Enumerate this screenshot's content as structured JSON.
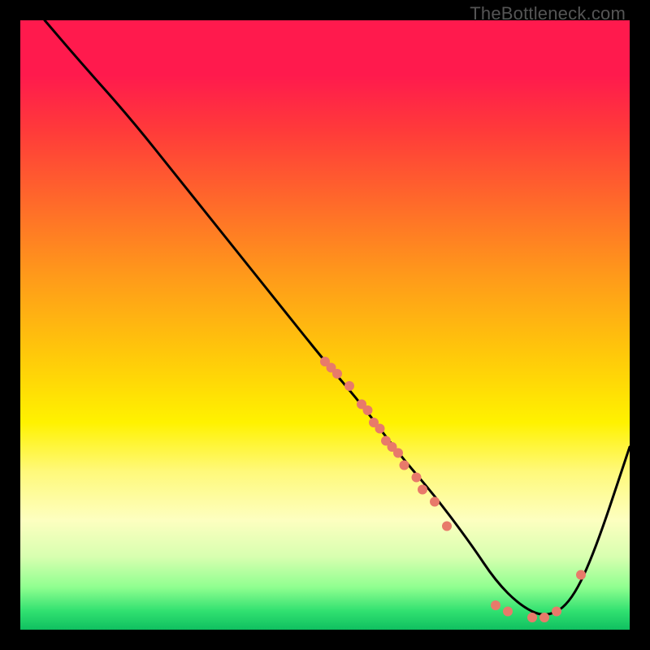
{
  "watermark": "TheBottleneck.com",
  "chart_data": {
    "type": "line",
    "title": "",
    "xlabel": "",
    "ylabel": "",
    "xlim": [
      0,
      100
    ],
    "ylim": [
      0,
      100
    ],
    "axes_visible": false,
    "grid": false,
    "background_gradient": {
      "stops": [
        {
          "t": 0.0,
          "color": "#ff1a4d"
        },
        {
          "t": 0.18,
          "color": "#ff3a3a"
        },
        {
          "t": 0.42,
          "color": "#ff9a1a"
        },
        {
          "t": 0.66,
          "color": "#fff200"
        },
        {
          "t": 0.88,
          "color": "#d8ffb0"
        },
        {
          "t": 1.0,
          "color": "#10c060"
        }
      ]
    },
    "series": [
      {
        "name": "bottleneck-curve",
        "color": "#000000",
        "x": [
          4,
          10,
          18,
          26,
          34,
          42,
          50,
          56,
          62,
          68,
          74,
          78,
          82,
          86,
          90,
          94,
          100
        ],
        "y": [
          100,
          93,
          84,
          74,
          64,
          54,
          44,
          37,
          29,
          22,
          14,
          8,
          4,
          2,
          4,
          12,
          30
        ]
      }
    ],
    "scatter": [
      {
        "name": "curve-markers",
        "color": "#e87a6a",
        "radius_px": 6,
        "points": [
          {
            "x": 50,
            "y": 44
          },
          {
            "x": 51,
            "y": 43
          },
          {
            "x": 52,
            "y": 42
          },
          {
            "x": 54,
            "y": 40
          },
          {
            "x": 56,
            "y": 37
          },
          {
            "x": 57,
            "y": 36
          },
          {
            "x": 58,
            "y": 34
          },
          {
            "x": 59,
            "y": 33
          },
          {
            "x": 60,
            "y": 31
          },
          {
            "x": 61,
            "y": 30
          },
          {
            "x": 62,
            "y": 29
          },
          {
            "x": 63,
            "y": 27
          },
          {
            "x": 65,
            "y": 25
          },
          {
            "x": 66,
            "y": 23
          },
          {
            "x": 68,
            "y": 21
          },
          {
            "x": 70,
            "y": 17
          },
          {
            "x": 78,
            "y": 4
          },
          {
            "x": 80,
            "y": 3
          },
          {
            "x": 84,
            "y": 2
          },
          {
            "x": 86,
            "y": 2
          },
          {
            "x": 88,
            "y": 3
          },
          {
            "x": 92,
            "y": 9
          }
        ]
      }
    ]
  }
}
